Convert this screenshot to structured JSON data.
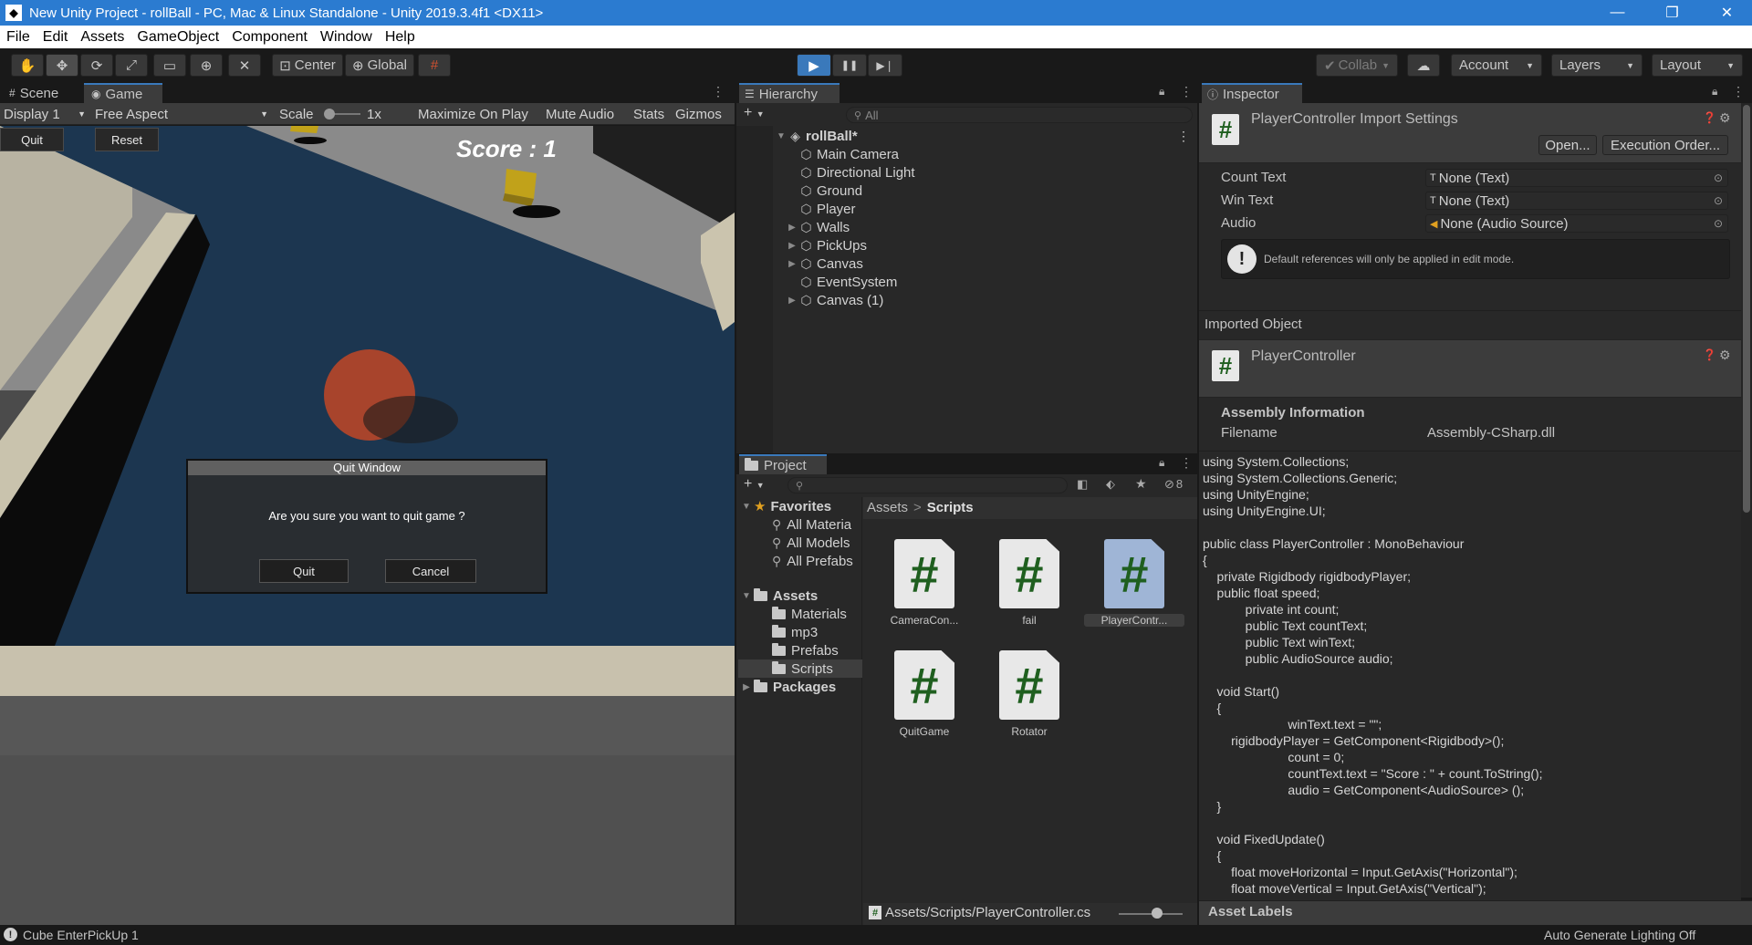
{
  "window": {
    "title": "New Unity Project - rollBall - PC, Mac & Linux Standalone - Unity 2019.3.4f1 <DX11>",
    "icon": "unity-logo-icon",
    "minimize": "—",
    "maximize": "❐",
    "close": "✕"
  },
  "menu": [
    "File",
    "Edit",
    "Assets",
    "GameObject",
    "Component",
    "Window",
    "Help"
  ],
  "toolbar": {
    "pivot": "Center",
    "space": "Global",
    "collab": "Collab",
    "account": "Account",
    "layers": "Layers",
    "layout": "Layout",
    "play_icon": "▶",
    "pause_icon": "❚❚",
    "step_icon": "▶❘"
  },
  "game_panel": {
    "tab_scene": "Scene",
    "tab_game": "Game",
    "display": "Display 1",
    "aspect": "Free Aspect",
    "scale_label": "Scale",
    "scale_value": "1x",
    "maximize_on_play": "Maximize On Play",
    "mute_audio": "Mute Audio",
    "stats": "Stats",
    "gizmos": "Gizmos",
    "quit_button": "Quit",
    "reset_button": "Reset",
    "score": "Score : 1",
    "dialog": {
      "title": "Quit Window",
      "message": "Are you sure you want to quit game ?",
      "quit": "Quit",
      "cancel": "Cancel"
    }
  },
  "hierarchy": {
    "tab": "Hierarchy",
    "search_placeholder": "All",
    "scene": "rollBall*",
    "items": [
      {
        "label": "Main Camera",
        "expandable": false
      },
      {
        "label": "Directional Light",
        "expandable": false
      },
      {
        "label": "Ground",
        "expandable": false
      },
      {
        "label": "Player",
        "expandable": false
      },
      {
        "label": "Walls",
        "expandable": true
      },
      {
        "label": "PickUps",
        "expandable": true
      },
      {
        "label": "Canvas",
        "expandable": true
      },
      {
        "label": "EventSystem",
        "expandable": false
      },
      {
        "label": "Canvas (1)",
        "expandable": true
      }
    ]
  },
  "project": {
    "tab": "Project",
    "hidden_count": "8",
    "favorites": "Favorites",
    "favorite_items": [
      "All Materia",
      "All Models",
      "All Prefabs"
    ],
    "assets": "Assets",
    "asset_folders": [
      "Materials",
      "mp3",
      "Prefabs",
      "Scripts"
    ],
    "packages": "Packages",
    "breadcrumb_root": "Assets",
    "breadcrumb_sep": ">",
    "breadcrumb_current": "Scripts",
    "files": [
      "CameraCon...",
      "fail",
      "PlayerContr...",
      "QuitGame",
      "Rotator"
    ],
    "selected_path": "Assets/Scripts/PlayerController.cs"
  },
  "inspector": {
    "tab": "Inspector",
    "header_title": "PlayerController Import Settings",
    "open_button": "Open...",
    "execution_order_button": "Execution Order...",
    "fields": [
      {
        "label": "Count Text",
        "value": "None (Text)"
      },
      {
        "label": "Win Text",
        "value": "None (Text)"
      },
      {
        "label": "Audio",
        "value": "None (Audio Source)"
      }
    ],
    "notice": "Default references will only be applied in edit mode.",
    "imported_object": "Imported Object",
    "object_name": "PlayerController",
    "assembly_info": "Assembly Information",
    "filename_label": "Filename",
    "filename_value": "Assembly-CSharp.dll",
    "code_lines": [
      "using System.Collections;",
      "using System.Collections.Generic;",
      "using UnityEngine;",
      "using UnityEngine.UI;",
      "",
      "public class PlayerController : MonoBehaviour",
      "{",
      "    private Rigidbody rigidbodyPlayer;",
      "    public float speed;",
      "            private int count;",
      "            public Text countText;",
      "            public Text winText;",
      "            public AudioSource audio;",
      "",
      "    void Start()",
      "    {",
      "                        winText.text = \"\";",
      "        rigidbodyPlayer = GetComponent<Rigidbody>();",
      "                        count = 0;",
      "                        countText.text = \"Score : \" + count.ToString();",
      "                        audio = GetComponent<AudioSource> ();",
      "    }",
      "",
      "    void FixedUpdate()",
      "    {",
      "        float moveHorizontal = Input.GetAxis(\"Horizontal\");",
      "        float moveVertical = Input.GetAxis(\"Vertical\");"
    ],
    "asset_labels": "Asset Labels"
  },
  "status": {
    "message": "Cube EnterPickUp 1",
    "lighting": "Auto Generate Lighting Off"
  }
}
